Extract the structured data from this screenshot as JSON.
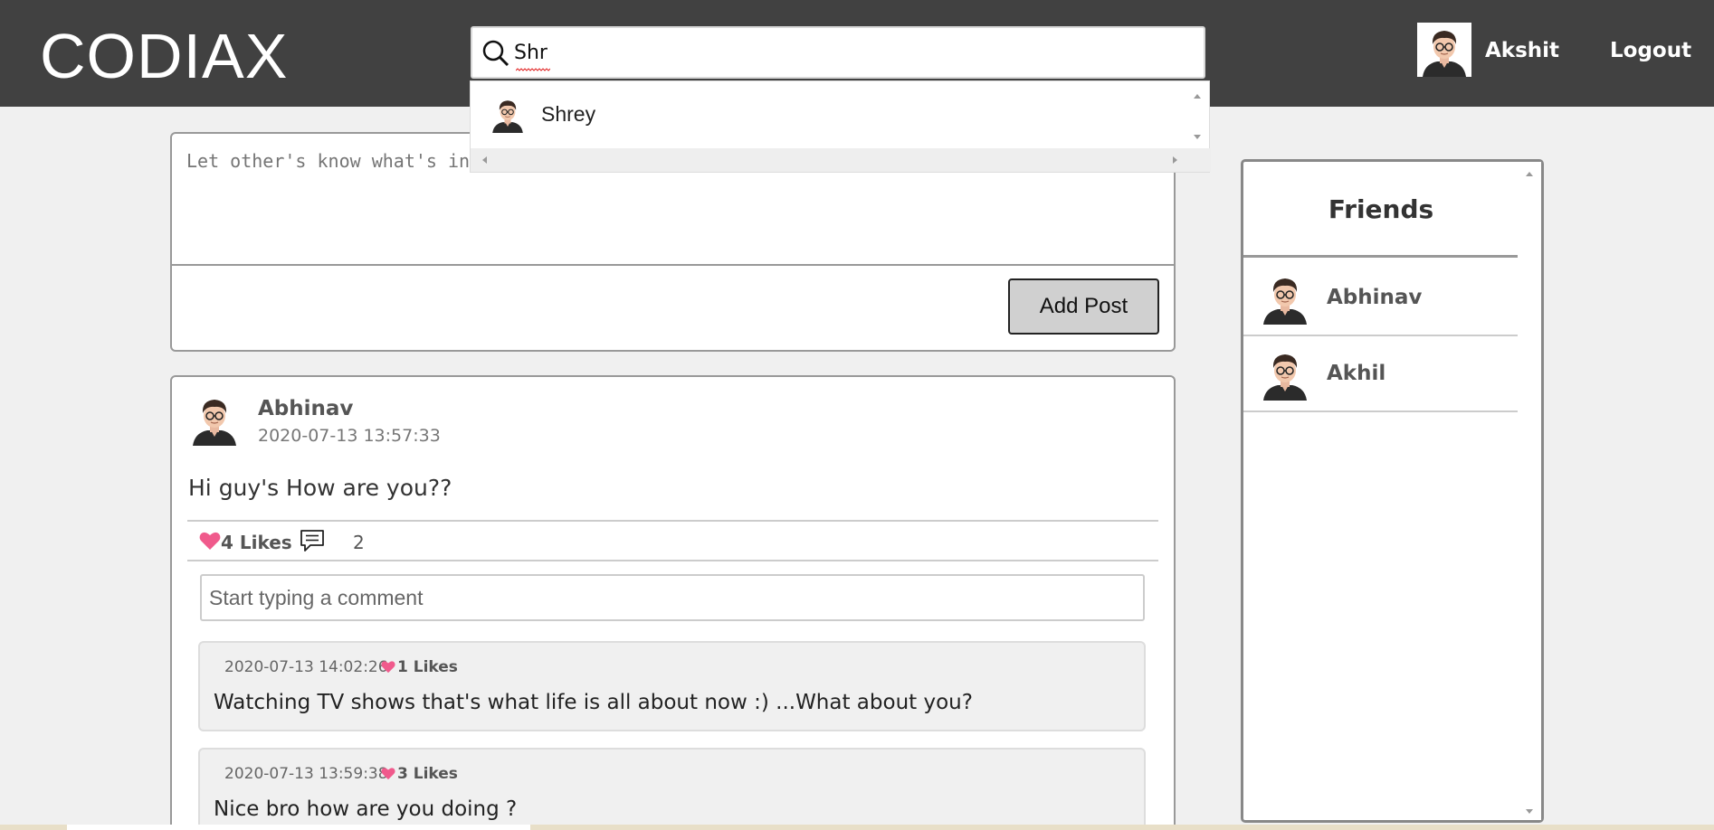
{
  "header": {
    "logo": "CODIAX",
    "search_value": "Shr",
    "user_name": "Akshit",
    "logout_label": "Logout"
  },
  "search_results": [
    {
      "name": "Shrey",
      "icon": "avatar"
    }
  ],
  "post_form": {
    "placeholder": "Let other's know what's in your mind",
    "add_post_label": "Add Post"
  },
  "post": {
    "author": "Abhinav",
    "time": "2020-07-13 13:57:33",
    "content": "Hi guy's How are you??",
    "likes_label": "4 Likes",
    "comments_count": "2",
    "comment_placeholder": "Start typing a comment",
    "comments": [
      {
        "time": "2020-07-13 14:02:26",
        "likes_label": "1 Likes",
        "text": "Watching TV shows that's what life is all about now :) ...What about you?"
      },
      {
        "time": "2020-07-13 13:59:38",
        "likes_label": "3 Likes",
        "text": "Nice bro how are you doing ?"
      }
    ]
  },
  "friends": {
    "title": "Friends",
    "list": [
      {
        "name": "Abhinav"
      },
      {
        "name": "Akhil"
      }
    ]
  },
  "colors": {
    "header_bg": "#414141",
    "like_pink": "#f05a8c"
  }
}
